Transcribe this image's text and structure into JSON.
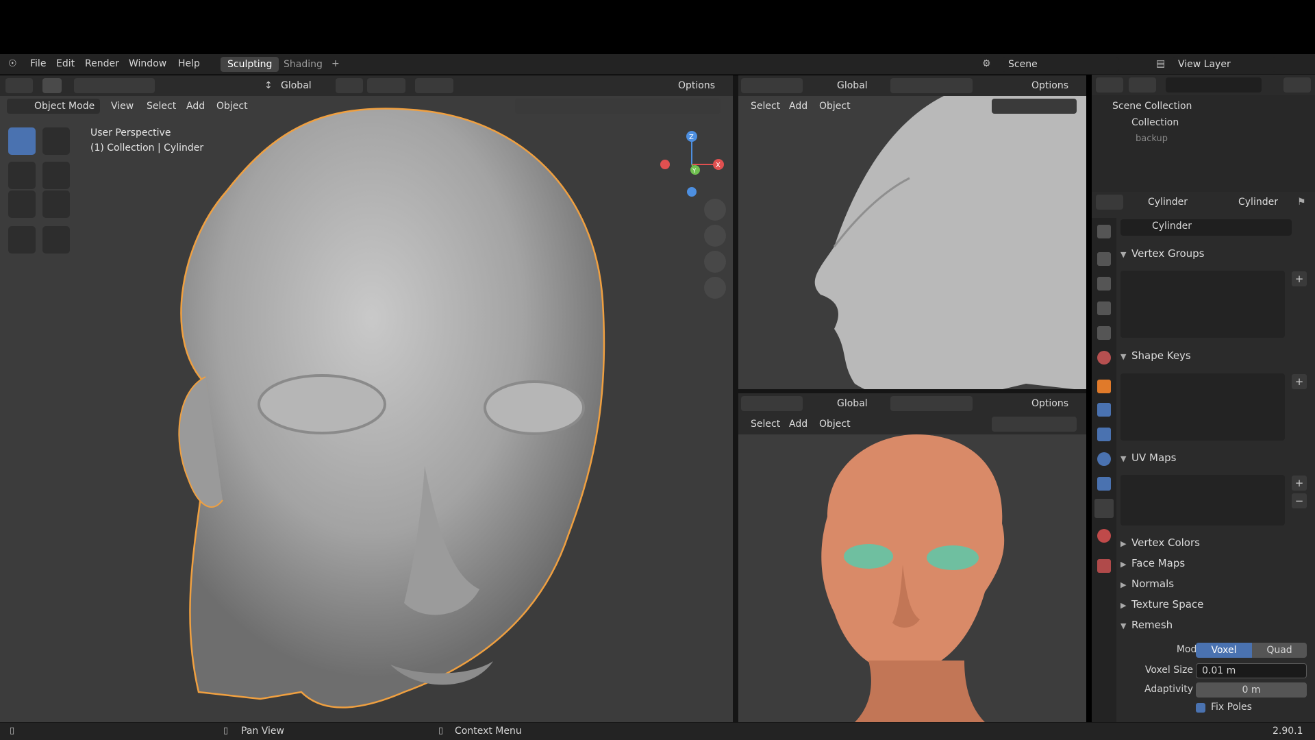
{
  "top_menu": {
    "file": "File",
    "edit": "Edit",
    "render": "Render",
    "window": "Window",
    "help": "Help",
    "workspace_tabs": [
      "Sculpting",
      "Shading"
    ],
    "add_tab": "+",
    "scene": "Scene",
    "view_layer": "View Layer"
  },
  "main_view": {
    "orientation": "Global",
    "options": "Options",
    "mode": "Object Mode",
    "menus": [
      "View",
      "Select",
      "Add",
      "Object"
    ],
    "overlay_line1": "User Perspective",
    "overlay_line2": "(1) Collection | Cylinder",
    "gizmo": {
      "z": "Z",
      "y": "Y",
      "x": "X"
    }
  },
  "right_top_view": {
    "orientation": "Global",
    "options": "Options",
    "menus": [
      "Select",
      "Add",
      "Object"
    ]
  },
  "right_bottom_view": {
    "orientation": "Global",
    "options": "Options",
    "menus": [
      "Select",
      "Add",
      "Object"
    ]
  },
  "outliner": {
    "root": "Scene Collection",
    "items": [
      "Collection",
      "backup"
    ]
  },
  "properties": {
    "object_name": "Cylinder",
    "data_name": "Cylinder",
    "mesh_name": "Cylinder",
    "panels": {
      "vertex_groups": "Vertex Groups",
      "shape_keys": "Shape Keys",
      "uv_maps": "UV Maps",
      "vertex_colors": "Vertex Colors",
      "face_maps": "Face Maps",
      "normals": "Normals",
      "texture_space": "Texture Space",
      "remesh": "Remesh"
    },
    "remesh": {
      "mode_label": "Mode",
      "mode_voxel": "Voxel",
      "mode_quad": "Quad",
      "voxel_size_label": "Voxel Size",
      "voxel_size_value": "0.01 m",
      "adaptivity_label": "Adaptivity",
      "adaptivity_value": "0 m",
      "fix_poles_label": "Fix Poles"
    }
  },
  "status": {
    "pan_view": "Pan View",
    "context_menu": "Context Menu",
    "version": "2.90.1"
  },
  "colors": {
    "accent": "#4a72b0",
    "selection_outline": "#f0a040",
    "skin": "#d98a68",
    "eye": "#6fbfa0"
  }
}
